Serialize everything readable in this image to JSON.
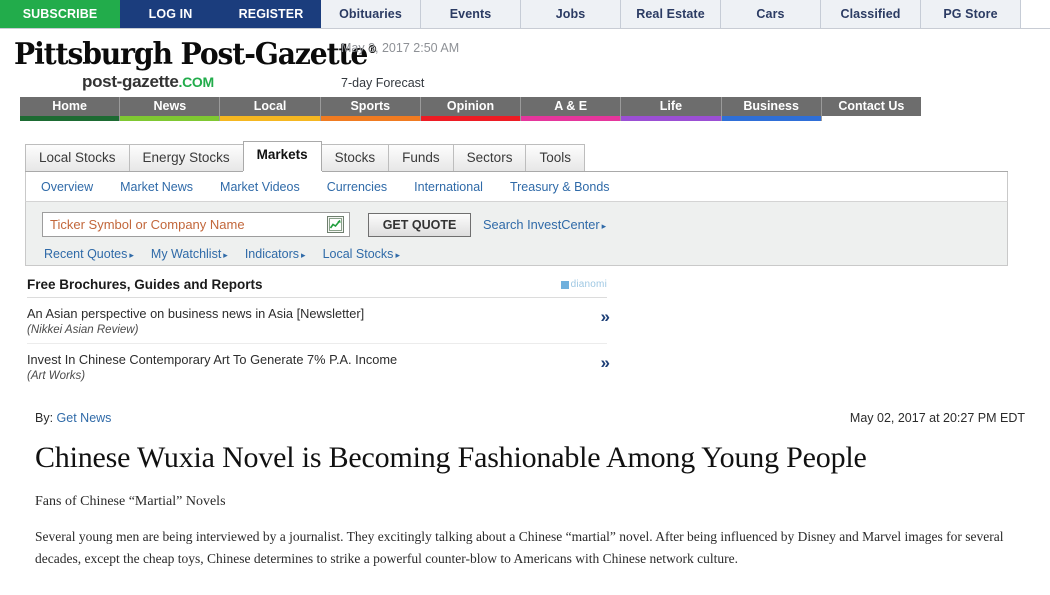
{
  "utility_nav": {
    "items": [
      {
        "label": "SUBSCRIBE",
        "style": "subscribe"
      },
      {
        "label": "LOG IN",
        "style": "login"
      },
      {
        "label": "REGISTER",
        "style": "register"
      },
      {
        "label": "Obituaries",
        "style": "plain"
      },
      {
        "label": "Events",
        "style": "plain"
      },
      {
        "label": "Jobs",
        "style": "plain"
      },
      {
        "label": "Real Estate",
        "style": "plain"
      },
      {
        "label": "Cars",
        "style": "plain"
      },
      {
        "label": "Classified",
        "style": "plain"
      },
      {
        "label": "PG Store",
        "style": "plain"
      }
    ]
  },
  "masthead": {
    "title": "Pittsburgh Post-Gazette",
    "registered_mark": "®",
    "domain_left": "post-gazette",
    "domain_right": ".COM",
    "datetime": "May 3, 2017 2:50 AM",
    "forecast_link": "7-day Forecast"
  },
  "main_nav": {
    "items": [
      {
        "label": "Home",
        "color": "#1d6b33"
      },
      {
        "label": "News",
        "color": "#7fc832"
      },
      {
        "label": "Local",
        "color": "#f5b721"
      },
      {
        "label": "Sports",
        "color": "#f07b21"
      },
      {
        "label": "Opinion",
        "color": "#ed1c24"
      },
      {
        "label": "A & E",
        "color": "#e5369c"
      },
      {
        "label": "Life",
        "color": "#9b4fd4"
      },
      {
        "label": "Business",
        "color": "#2f6fd8"
      },
      {
        "label": "Contact Us",
        "color": "#ffffff"
      }
    ]
  },
  "stock_widget": {
    "tabs": [
      {
        "label": "Local Stocks",
        "active": false
      },
      {
        "label": "Energy Stocks",
        "active": false
      },
      {
        "label": "Markets",
        "active": true
      },
      {
        "label": "Stocks",
        "active": false
      },
      {
        "label": "Funds",
        "active": false
      },
      {
        "label": "Sectors",
        "active": false
      },
      {
        "label": "Tools",
        "active": false
      }
    ],
    "subnav": [
      "Overview",
      "Market News",
      "Market Videos",
      "Currencies",
      "International",
      "Treasury & Bonds"
    ],
    "search": {
      "placeholder": "Ticker Symbol or Company Name",
      "value": "",
      "chart_icon": "chart-icon",
      "button_label": "GET QUOTE",
      "invest_center_link": "Search InvestCenter"
    },
    "quick_links": [
      "Recent Quotes",
      "My Watchlist",
      "Indicators",
      "Local Stocks"
    ]
  },
  "brochures": {
    "title": "Free Brochures, Guides and Reports",
    "provider": "dianomi",
    "items": [
      {
        "text": "An Asian perspective on business news in Asia [Newsletter]",
        "source": "(Nikkei Asian Review)",
        "arrow": "»"
      },
      {
        "text": "Invest In Chinese Contemporary Art To Generate 7% P.A. Income",
        "source": "(Art Works)",
        "arrow": "»"
      }
    ]
  },
  "article": {
    "byline_prefix": "By:",
    "author": "Get News",
    "published": "May 02, 2017 at 20:27 PM EDT",
    "headline": "Chinese Wuxia Novel is Becoming Fashionable Among Young People",
    "subhead": "Fans of Chinese “Martial” Novels",
    "paragraph": "Several young men are being interviewed by a journalist. They excitingly talking about a Chinese “martial” novel. After being influenced by Disney and Marvel images for several decades, except the cheap toys, Chinese determines to strike a powerful counter-blow to Americans with Chinese network culture."
  },
  "colors": {
    "subscribe_green": "#22ac4b",
    "nav_blue": "#1b3d7d",
    "link_blue": "#2f6aa8",
    "placeholder_orange": "#c2673b"
  }
}
